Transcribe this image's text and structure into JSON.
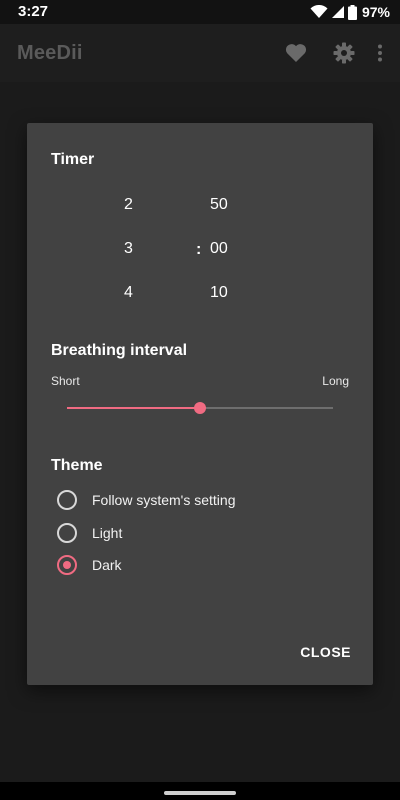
{
  "status_bar": {
    "time": "3:27",
    "battery": "97%"
  },
  "app_bar": {
    "title": "MeeDii",
    "actions": [
      "heart-icon",
      "gear-icon",
      "more-vert-icon"
    ]
  },
  "dialog": {
    "timer": {
      "title": "Timer",
      "minutes": {
        "prev": "2",
        "selected": "3",
        "next": "4"
      },
      "separator": ":",
      "seconds": {
        "prev": "50",
        "selected": "00",
        "next": "10"
      }
    },
    "breathing": {
      "title": "Breathing interval",
      "min_label": "Short",
      "max_label": "Long",
      "value": 0.5
    },
    "theme": {
      "title": "Theme",
      "options": [
        {
          "label": "Follow system's setting",
          "checked": false
        },
        {
          "label": "Light",
          "checked": false
        },
        {
          "label": "Dark",
          "checked": true
        }
      ]
    },
    "close_label": "CLOSE"
  },
  "colors": {
    "accent": "#f06b82",
    "dialog_bg": "#424242",
    "app_bg": "#1b1b1b"
  }
}
